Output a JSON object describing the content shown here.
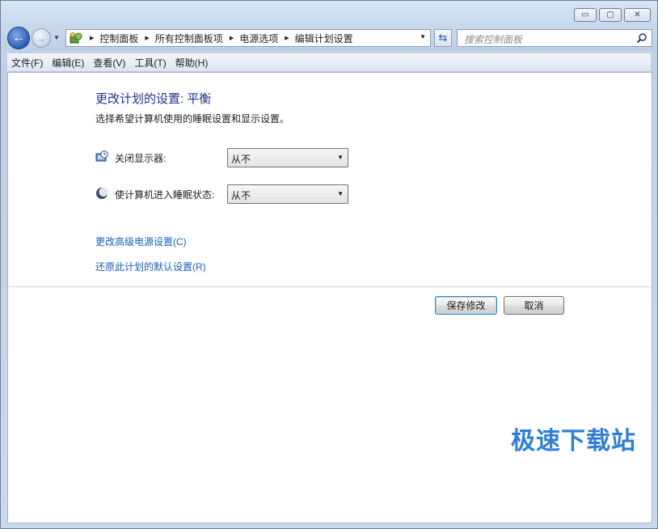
{
  "window": {
    "buttons": {
      "minimize": "▭",
      "maximize": "▢",
      "close": "✕"
    }
  },
  "nav": {
    "breadcrumb": [
      "控制面板",
      "所有控制面板项",
      "电源选项",
      "编辑计划设置"
    ],
    "search_placeholder": "搜索控制面板"
  },
  "menu": [
    "文件(F)",
    "编辑(E)",
    "查看(V)",
    "工具(T)",
    "帮助(H)"
  ],
  "page": {
    "title": "更改计划的设置: 平衡",
    "subtitle": "选择希望计算机使用的睡眠设置和显示设置。",
    "settings": [
      {
        "label": "关闭显示器:",
        "value": "从不",
        "icon": "monitor-clock-icon"
      },
      {
        "label": "使计算机进入睡眠状态:",
        "value": "从不",
        "icon": "sleep-moon-icon"
      }
    ],
    "links": [
      "更改高级电源设置(C)",
      "还原此计划的默认设置(R)"
    ],
    "save_label": "保存修改",
    "cancel_label": "取消"
  },
  "watermark": "极速下载站",
  "colors": {
    "accent": "#1e3287",
    "link": "#1560bd",
    "watermark": "#2f7fd6"
  }
}
